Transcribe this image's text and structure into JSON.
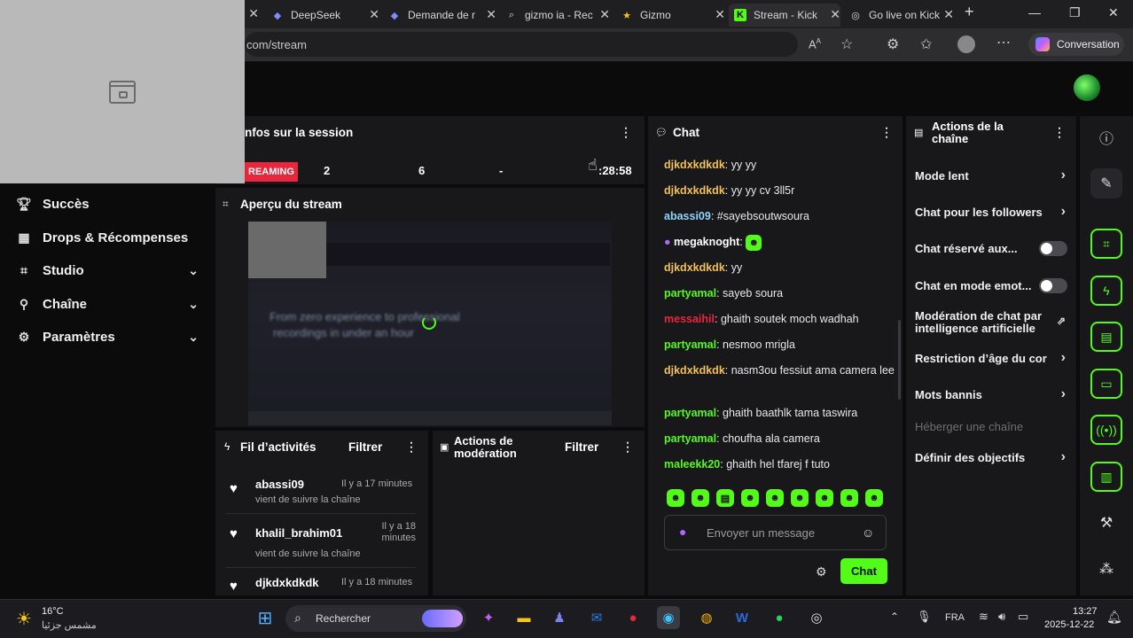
{
  "browser": {
    "tabs": [
      {
        "title": "DeepSeek",
        "icon": "deepseek-icon"
      },
      {
        "title": "Demande de r",
        "icon": "deepseek-icon"
      },
      {
        "title": "gizmo ia - Rec",
        "icon": "search-icon"
      },
      {
        "title": "Gizmo",
        "icon": "star-icon"
      },
      {
        "title": "Stream - Kick",
        "icon": "kick-icon"
      },
      {
        "title": "Go live on Kick",
        "icon": "globe-icon"
      }
    ],
    "url": "com/stream",
    "conversation_label": "Conversation"
  },
  "sidebar": {
    "items": [
      {
        "label": "Succès",
        "icon": "trophy-icon",
        "expandable": false
      },
      {
        "label": "Drops & Récompenses",
        "icon": "gift-icon",
        "expandable": false
      },
      {
        "label": "Studio",
        "icon": "studio-icon",
        "expandable": true
      },
      {
        "label": "Chaîne",
        "icon": "channel-icon",
        "expandable": true
      },
      {
        "label": "Paramètres",
        "icon": "gear-icon",
        "expandable": true
      }
    ]
  },
  "session": {
    "title": "nfos sur la session",
    "status": "REAMING",
    "stat1": "2",
    "stat2": "6",
    "stat3": "-",
    "duration": ":28:58"
  },
  "apercu": {
    "title": "Aperçu du stream",
    "preview_line1": "From zero experience to professional",
    "preview_line2": "recordings in under an hour"
  },
  "activity": {
    "title": "Fil d’activités",
    "filter_label": "Filtrer",
    "items": [
      {
        "user": "abassi09",
        "time": "Il y a 17 minutes",
        "desc": "vient de suivre la chaîne"
      },
      {
        "user": "khalil_brahim01",
        "time": "Il y a 18 minutes",
        "desc": "vient de suivre la chaîne"
      },
      {
        "user": "djkdxkdkdk",
        "time": "Il y a 18 minutes",
        "desc": ""
      }
    ]
  },
  "moderation": {
    "title": "Actions de modération",
    "filter_label": "Filtrer"
  },
  "chat": {
    "title": "Chat",
    "messages": [
      {
        "user": "djkdxkdkdk",
        "text": "yy yy",
        "color": "#f2c14e"
      },
      {
        "user": "djkdxkdkdk",
        "text": "yy yy cv 3ll5r",
        "color": "#f2c14e"
      },
      {
        "user": "abassi09",
        "text": "#sayebsoutwsoura",
        "color": "#8fd3ff"
      },
      {
        "user": "megaknoght",
        "text": "",
        "color": "#ffffff"
      },
      {
        "user": "djkdxkdkdk",
        "text": "yy",
        "color": "#f2c14e"
      },
      {
        "user": "partyamal",
        "text": "sayeb soura",
        "color": "#53fc18"
      },
      {
        "user": "messaihil",
        "text": "ghaith soutek moch wadhah",
        "color": "#e8263d"
      },
      {
        "user": "partyamal",
        "text": "nesmoo mrigla",
        "color": "#53fc18"
      },
      {
        "user": "djkdxkdkdk",
        "text": "nasm3ou fessiut ama camera lee",
        "color": "#f2c14e"
      },
      {
        "user": "partyamal",
        "text": "ghaith baathlk tama taswira",
        "color": "#53fc18"
      },
      {
        "user": "partyamal",
        "text": "choufha ala camera",
        "color": "#53fc18"
      },
      {
        "user": "maleekk20",
        "text": "ghaith hel tfarej f tuto",
        "color": "#53fc18"
      }
    ],
    "input_placeholder": "Envoyer un message",
    "send_label": "Chat"
  },
  "channel_actions": {
    "title": "Actions de la chaîne",
    "items": [
      {
        "label": "Mode lent",
        "control": "chevron"
      },
      {
        "label": "Chat pour les followers",
        "control": "chevron"
      },
      {
        "label": "Chat réservé aux...",
        "control": "toggle"
      },
      {
        "label": "Chat en mode emot...",
        "control": "toggle"
      },
      {
        "label": "Modération de chat par intelligence artificielle",
        "control": "external"
      },
      {
        "label": "Restriction d’âge du cor",
        "control": "chevron"
      },
      {
        "label": "Mots bannis",
        "control": "chevron"
      },
      {
        "label": "Héberger une chaîne",
        "control": "none"
      },
      {
        "label": "Définir des objectifs",
        "control": "chevron"
      }
    ]
  },
  "taskbar": {
    "weather_temp": "16°C",
    "weather_desc": "مشمس جزئيا",
    "search_placeholder": "Rechercher",
    "language": "FRA",
    "time": "13:27",
    "date": "2025-12-22"
  },
  "colors": {
    "accent": "#53fc18",
    "live_red": "#e8263d",
    "panel": "#18181b",
    "background": "#0b0b0c"
  }
}
